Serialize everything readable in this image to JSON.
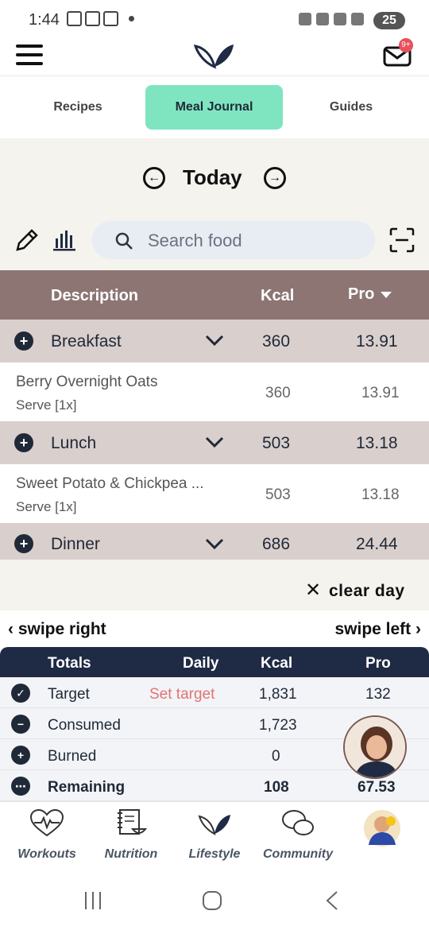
{
  "status_bar": {
    "time": "1:44",
    "battery": "25"
  },
  "header": {
    "mail_badge": "9+"
  },
  "tabs": [
    {
      "label": "Recipes",
      "active": false
    },
    {
      "label": "Meal Journal",
      "active": true
    },
    {
      "label": "Guides",
      "active": false
    }
  ],
  "day_nav": {
    "title": "Today"
  },
  "search": {
    "placeholder": "Search food"
  },
  "table": {
    "headers": {
      "description": "Description",
      "kcal": "Kcal",
      "pro": "Pro"
    },
    "meals": [
      {
        "name": "Breakfast",
        "kcal": "360",
        "pro": "13.91",
        "items": [
          {
            "name": "Berry Overnight Oats",
            "serve": "Serve [1x]",
            "kcal": "360",
            "pro": "13.91"
          }
        ]
      },
      {
        "name": "Lunch",
        "kcal": "503",
        "pro": "13.18",
        "items": [
          {
            "name": "Sweet Potato & Chickpea ...",
            "serve": "Serve [1x]",
            "kcal": "503",
            "pro": "13.18"
          }
        ]
      },
      {
        "name": "Dinner",
        "kcal": "686",
        "pro": "24.44",
        "items": []
      }
    ]
  },
  "actions": {
    "clear_day": "clear day",
    "swipe_right": "swipe right",
    "swipe_left": "swipe left"
  },
  "totals": {
    "headers": {
      "totals": "Totals",
      "daily": "Daily",
      "kcal": "Kcal",
      "pro": "Pro"
    },
    "rows": [
      {
        "label": "Target",
        "daily": "Set target",
        "kcal": "1,831",
        "pro": "132"
      },
      {
        "label": "Consumed",
        "daily": "",
        "kcal": "1,723",
        "pro": ""
      },
      {
        "label": "Burned",
        "daily": "",
        "kcal": "0",
        "pro": ""
      },
      {
        "label": "Remaining",
        "daily": "",
        "kcal": "108",
        "pro": "67.53"
      }
    ]
  },
  "bottom_nav": [
    {
      "label": "Workouts",
      "icon": "heart-pulse-icon"
    },
    {
      "label": "Nutrition",
      "icon": "recipe-book-icon"
    },
    {
      "label": "Lifestyle",
      "icon": "leaf-icon"
    },
    {
      "label": "Community",
      "icon": "chat-bubbles-icon"
    },
    {
      "label": "",
      "icon": "profile-avatar"
    }
  ],
  "colors": {
    "accent": "#7fe5c0",
    "table_header": "#8c7573",
    "meal_row": "#d9cfcd",
    "totals_header": "#1f2a44",
    "warning_text": "#e27474"
  }
}
